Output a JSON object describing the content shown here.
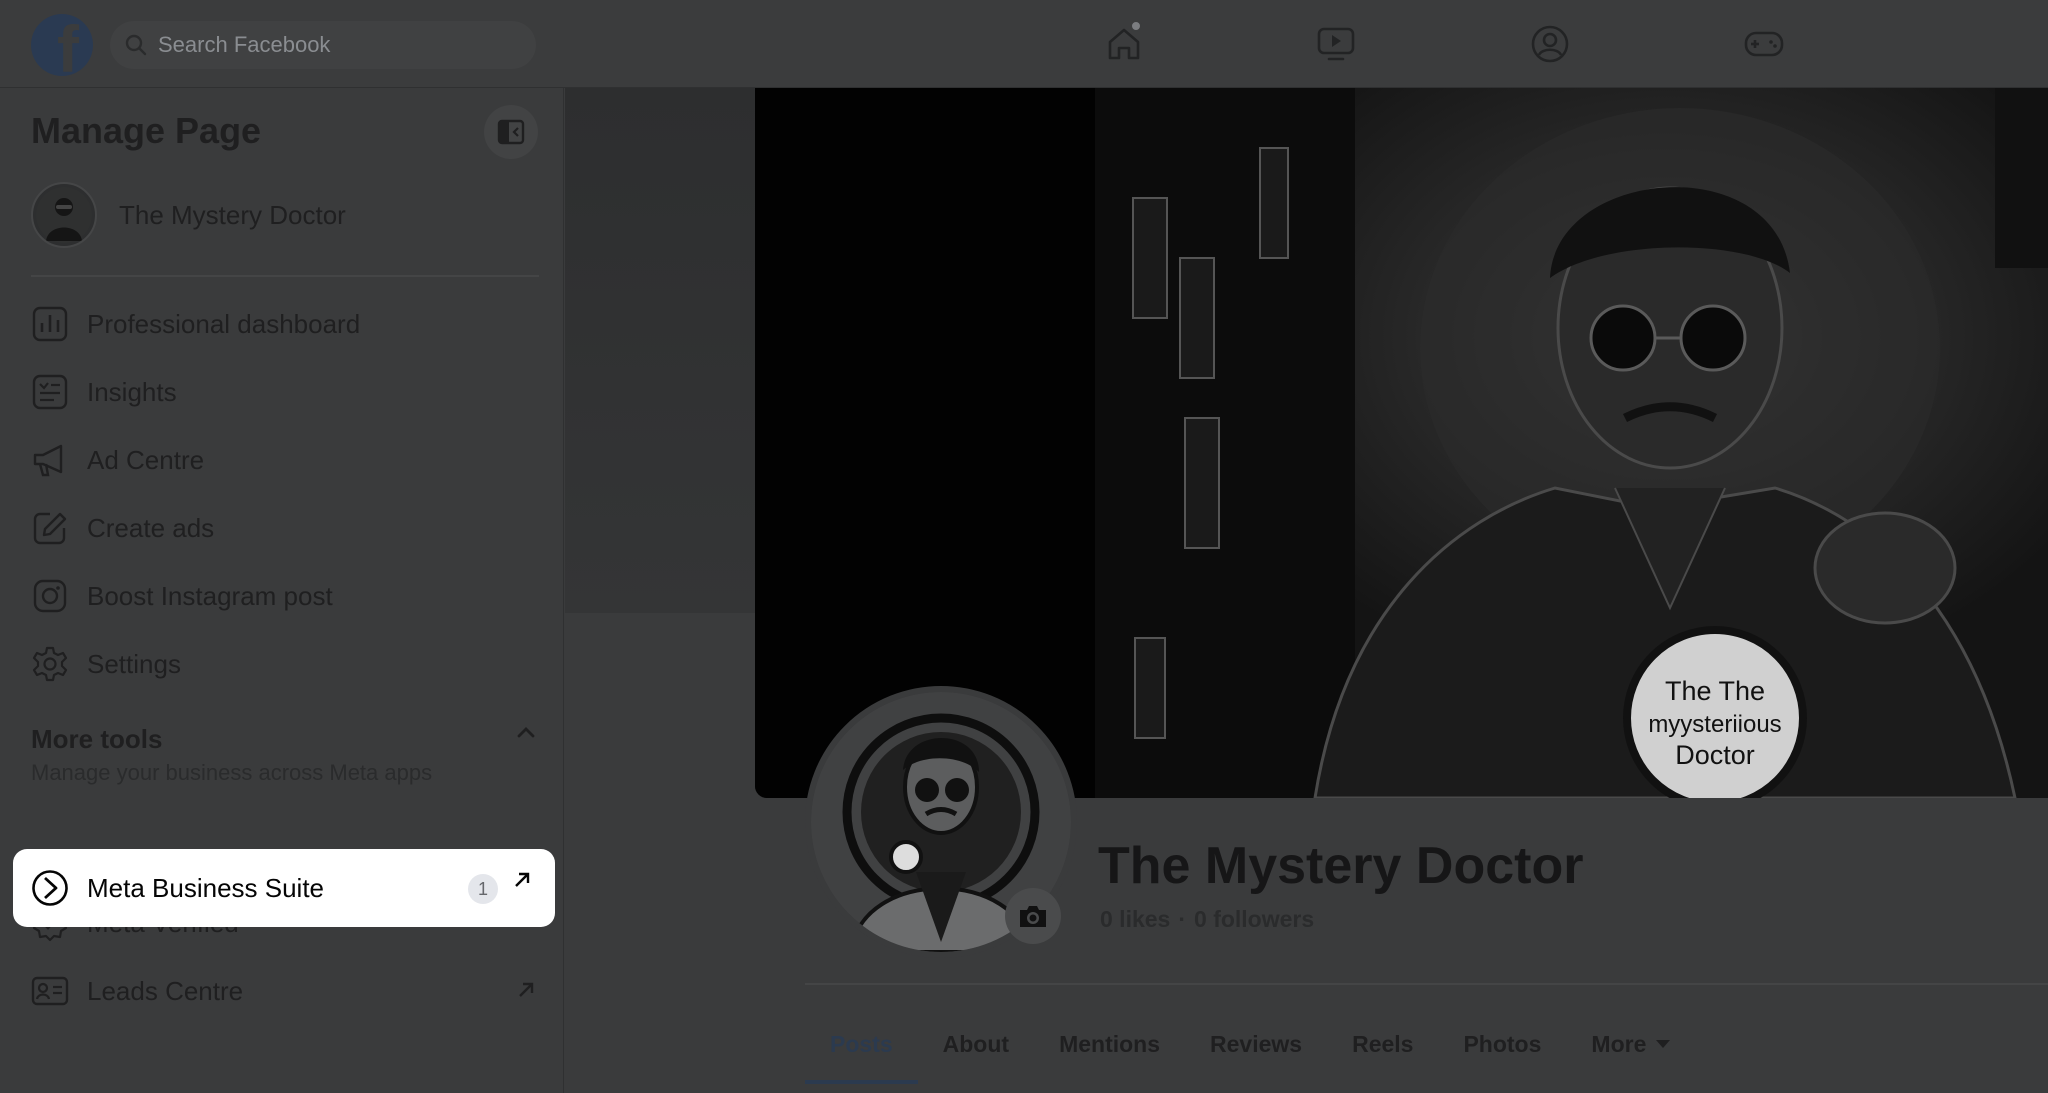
{
  "topbar": {
    "logo_letter": "f",
    "search_placeholder": "Search Facebook",
    "nav_icons": [
      "home-icon",
      "video-icon",
      "profile-circle-icon",
      "gaming-icon"
    ]
  },
  "sidebar": {
    "title": "Manage Page",
    "page_name": "The Mystery Doctor",
    "items": [
      {
        "label": "Professional dashboard",
        "icon": "dashboard-icon"
      },
      {
        "label": "Insights",
        "icon": "insights-icon"
      },
      {
        "label": "Ad Centre",
        "icon": "megaphone-icon"
      },
      {
        "label": "Create ads",
        "icon": "edit-icon"
      },
      {
        "label": "Boost Instagram post",
        "icon": "instagram-icon"
      },
      {
        "label": "Settings",
        "icon": "gear-icon"
      }
    ],
    "more_tools": {
      "title": "More tools",
      "subtitle": "Manage your business across Meta apps",
      "items": [
        {
          "label": "Meta Verified",
          "icon": "verified-badge-icon"
        },
        {
          "label": "Leads Centre",
          "icon": "id-card-icon"
        },
        {
          "label": "Meta Business Suite",
          "icon": "business-suite-icon",
          "badge": "1"
        }
      ]
    }
  },
  "profile": {
    "name": "The Mystery Doctor",
    "likes": "0 likes",
    "separator": "·",
    "followers": "0 followers",
    "cover_badge_text": [
      "The The",
      "myysteriious",
      "Doctor"
    ]
  },
  "tabs": [
    {
      "label": "Posts",
      "active": true
    },
    {
      "label": "About"
    },
    {
      "label": "Mentions"
    },
    {
      "label": "Reviews"
    },
    {
      "label": "Reels"
    },
    {
      "label": "Photos"
    },
    {
      "label": "More"
    }
  ],
  "colors": {
    "overlay_background": "#3a3b3c",
    "highlight_background": "#ffffff",
    "active_tab": "#2b3a4f"
  }
}
